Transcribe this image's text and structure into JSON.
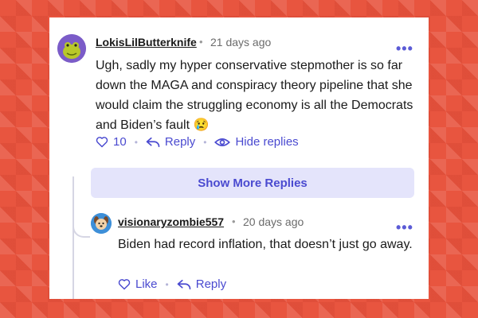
{
  "comments": [
    {
      "username": "LokisLilButterknife",
      "time": "21 days ago",
      "text": "Ugh, sadly my hyper conservative stepmother is so far down the MAGA and conspiracy theory pipeline that she would claim the struggling economy is all the Democrats and Biden’s fault 😢",
      "like_count": "10",
      "reply_label": "Reply",
      "hide_replies_label": "Hide replies"
    },
    {
      "username": "visionaryzombie557",
      "time": "20 days ago",
      "text": "Biden had record inflation, that doesn’t just go away.",
      "like_label": "Like",
      "reply_label": "Reply"
    }
  ],
  "show_more_label": "Show More Replies",
  "more_menu_glyph": "•••",
  "separator": "•",
  "colors": {
    "accent": "#4a4ad0",
    "button_bg": "#e4e4fb",
    "background": "#e8553f"
  }
}
